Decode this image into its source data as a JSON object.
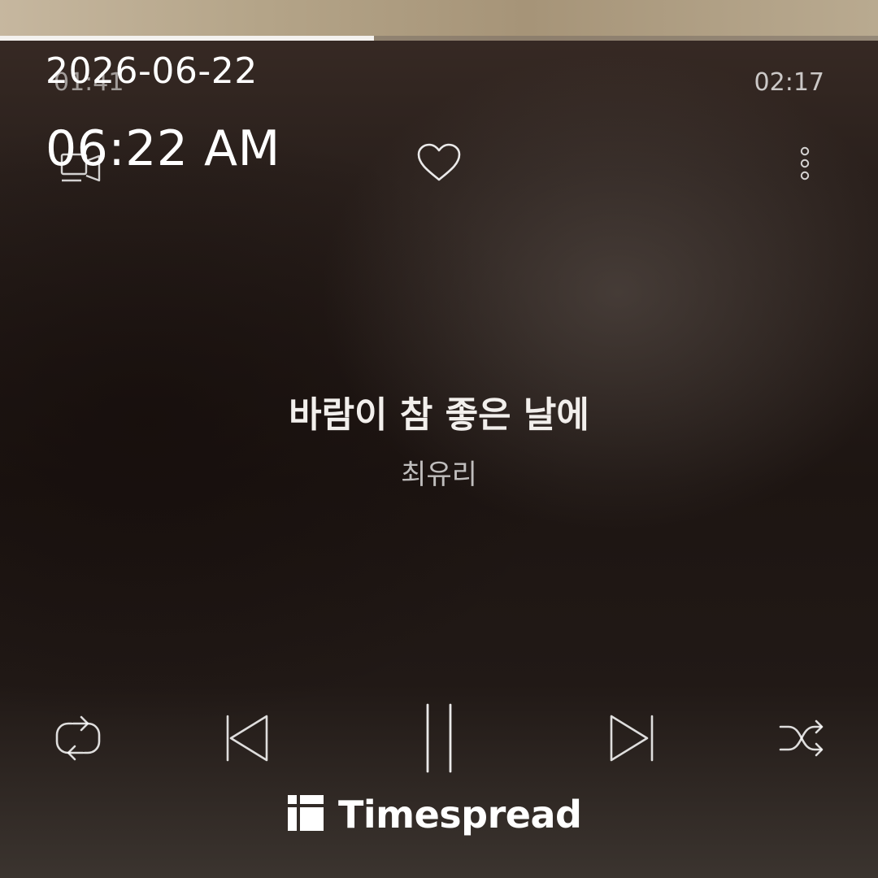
{
  "player": {
    "progress_fraction": 0.426,
    "elapsed_time": "01:41",
    "total_time": "02:17"
  },
  "overlay": {
    "date": "2026-06-22",
    "time": "06:22 AM"
  },
  "track": {
    "title": "바람이 참 좋은 날에",
    "artist": "최유리"
  },
  "icons": {
    "top_left": "lyrics-icon",
    "like": "heart-icon",
    "more": "more-vertical-icon",
    "repeat": "repeat-icon",
    "previous": "skip-previous-icon",
    "play_pause": "pause-icon",
    "next": "skip-next-icon",
    "shuffle": "shuffle-icon"
  },
  "watermark": {
    "brand": "Timespread"
  }
}
